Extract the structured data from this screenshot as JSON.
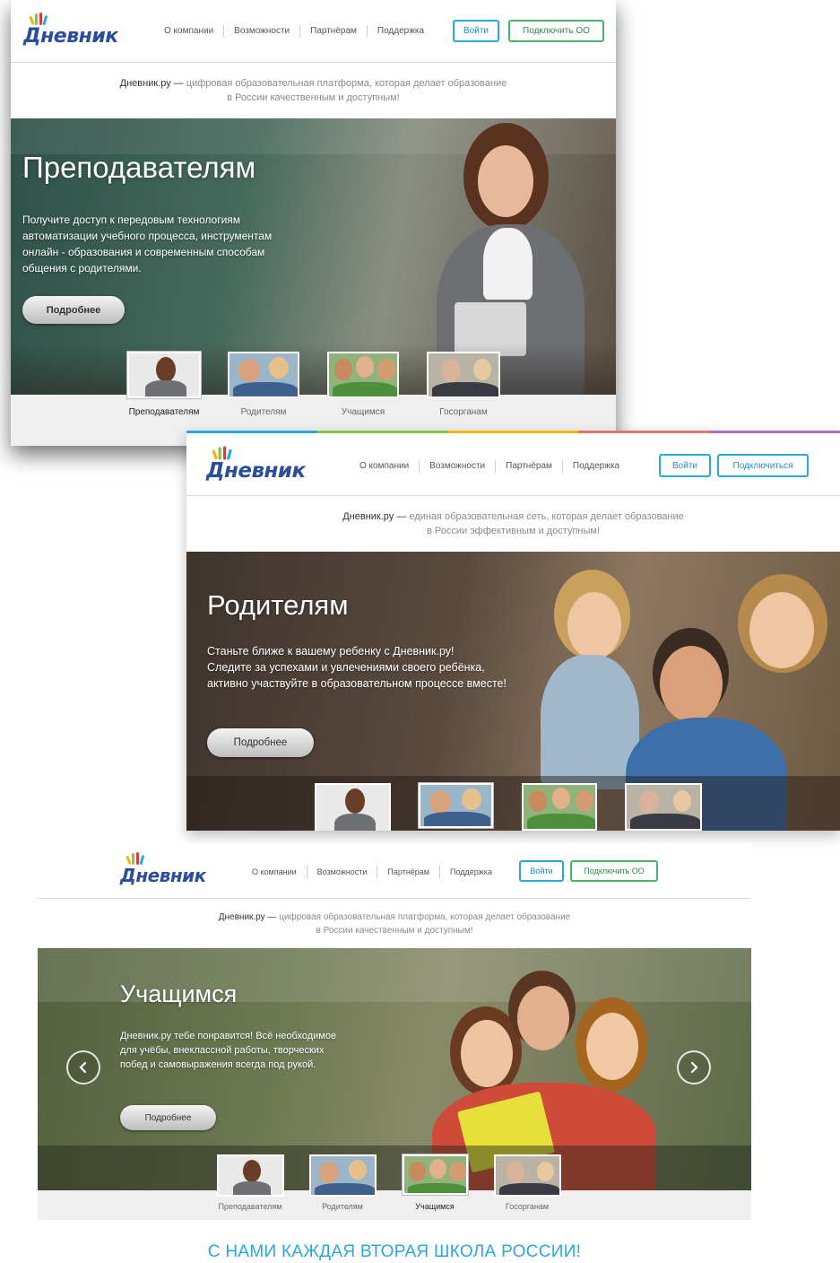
{
  "brand": {
    "logo_text": "Дневник",
    "colors": {
      "blue": "#29a8dd",
      "green": "#4db36b",
      "logo_blue": "#2a4e9c"
    }
  },
  "nav": [
    "О компании",
    "Возможности",
    "Партнёрам",
    "Поддержка"
  ],
  "login_label": "Войти",
  "thumb_labels": [
    "Преподавателям",
    "Родителям",
    "Учащимся",
    "Госорганам"
  ],
  "screens": [
    {
      "connect_label": "Подключить ОО",
      "tagline_brand": "Дневник.ру —",
      "tagline_line1": " цифровая образовательная платформа, которая делает образование",
      "tagline_line2": "в России качественным и доступным!",
      "hero_title": "Преподавателям",
      "hero_text": "Получите доступ к передовым технологиям\nавтоматизации учебного процесса, инструментам\nонлайн - образования и современным способам\nобщения с родителями.",
      "more_label": "Подробнее",
      "active_thumb": 0
    },
    {
      "connect_label": "Подключиться",
      "tagline_brand": "Дневник.ру —",
      "tagline_line1": " единая образовательная сеть, которая делает образование",
      "tagline_line2": "в России эффективным и доступным!",
      "hero_title": "Родителям",
      "hero_text": "Станьте ближе к вашему ребенку с Дневник.ру!\nСледите за успехами и увлечениями своего ребёнка,\nактивно участвуйте в образовательном процессе вместе!",
      "more_label": "Подробнее",
      "active_thumb": 1
    },
    {
      "connect_label": "Подключить ОО",
      "tagline_brand": "Дневник.ру —",
      "tagline_line1": " цифровая образовательная платформа, которая делает образование",
      "tagline_line2": "в России качественным и доступным!",
      "hero_title": "Учащимся",
      "hero_text": "Дневник.ру тебе понравится! Всё необходимое\nдля учёбы, внеклассной работы, творческих\nпобед и самовыражения всегда под рукой.",
      "more_label": "Подробнее",
      "active_thumb": 2,
      "slogan": "С НАМИ КАЖДАЯ ВТОРАЯ ШКОЛА РОССИИ!"
    }
  ]
}
